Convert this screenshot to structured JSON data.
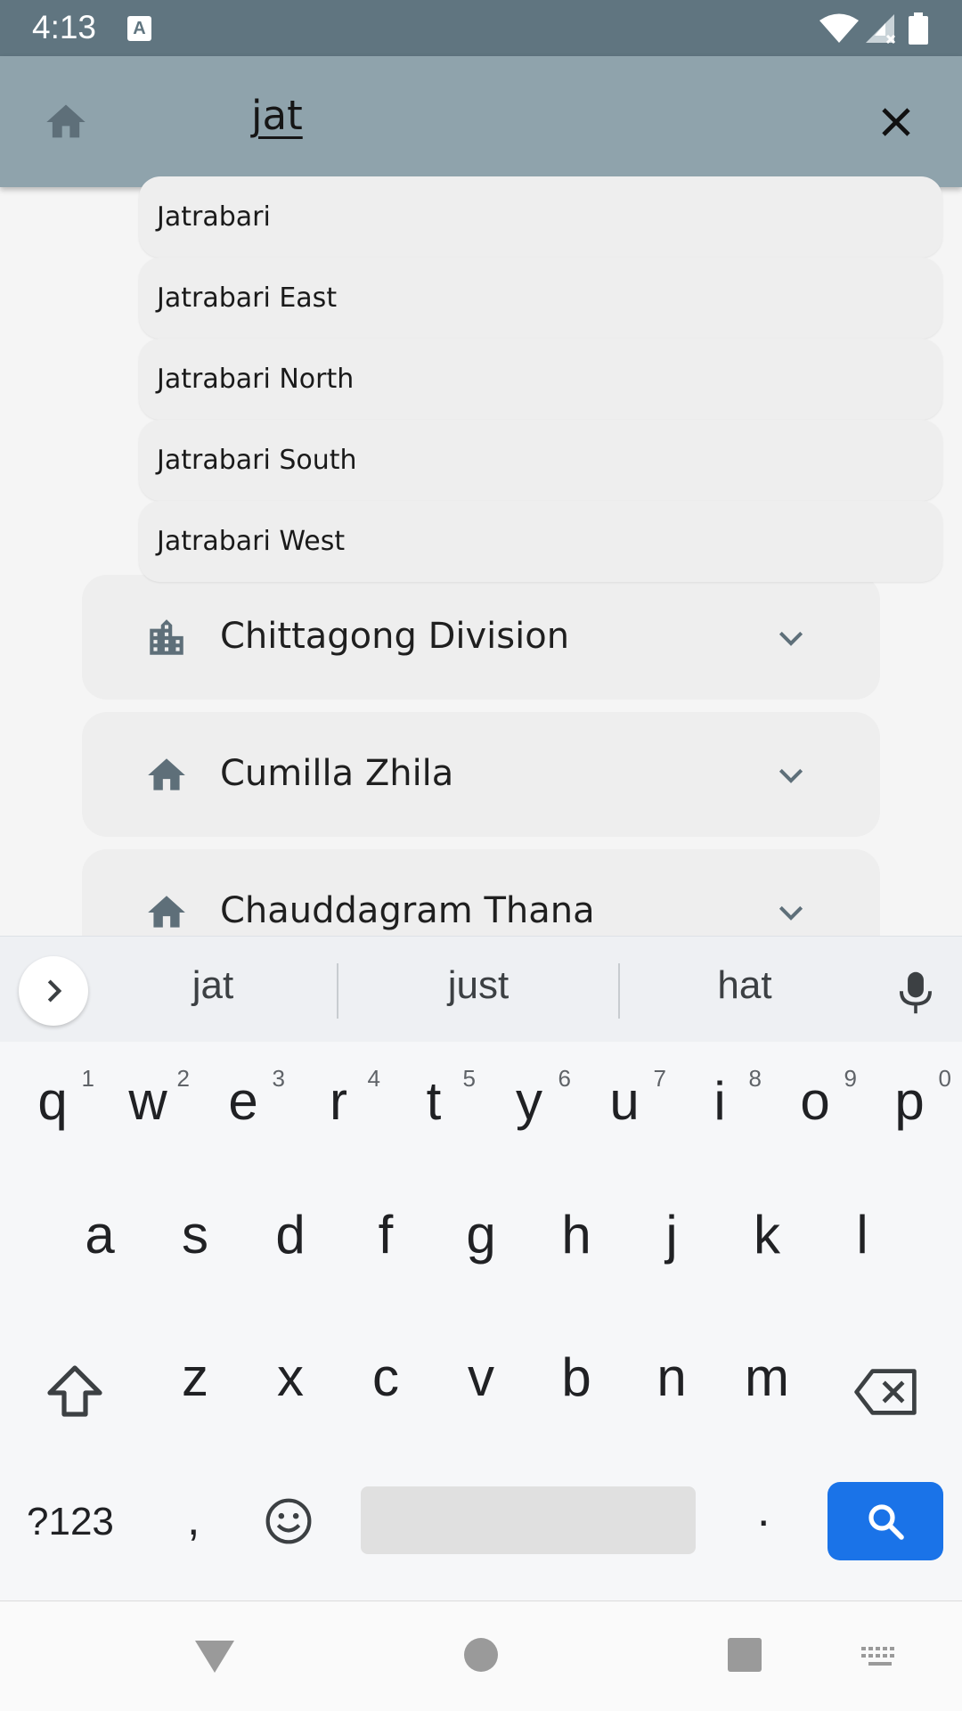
{
  "status_bar": {
    "time": "4:13",
    "notification_icon_letter": "A"
  },
  "app_bar": {
    "search_query": "jat"
  },
  "suggestions": [
    "Jatrabari",
    "Jatrabari East",
    "Jatrabari North",
    "Jatrabari South",
    "Jatrabari West"
  ],
  "cards": [
    {
      "label": "Chittagong Division",
      "icon": "city-icon"
    },
    {
      "label": "Cumilla Zhila",
      "icon": "home-icon"
    },
    {
      "label": "Chauddagram Thana",
      "icon": "home-icon"
    }
  ],
  "keyboard": {
    "suggestions": [
      "jat",
      "just",
      "hat"
    ],
    "row1": [
      "q",
      "w",
      "e",
      "r",
      "t",
      "y",
      "u",
      "i",
      "o",
      "p"
    ],
    "row1_numbers": [
      "1",
      "2",
      "3",
      "4",
      "5",
      "6",
      "7",
      "8",
      "9",
      "0"
    ],
    "row2": [
      "a",
      "s",
      "d",
      "f",
      "g",
      "h",
      "j",
      "k",
      "l"
    ],
    "row3": [
      "z",
      "x",
      "c",
      "v",
      "b",
      "n",
      "m"
    ],
    "symbols_label": "?123",
    "comma": ",",
    "period": "."
  },
  "colors": {
    "status_bar": "#607580",
    "app_bar": "#8fa3ac",
    "card": "#eeeeee",
    "search_key": "#1a73e8",
    "icon": "#5e6f79"
  }
}
